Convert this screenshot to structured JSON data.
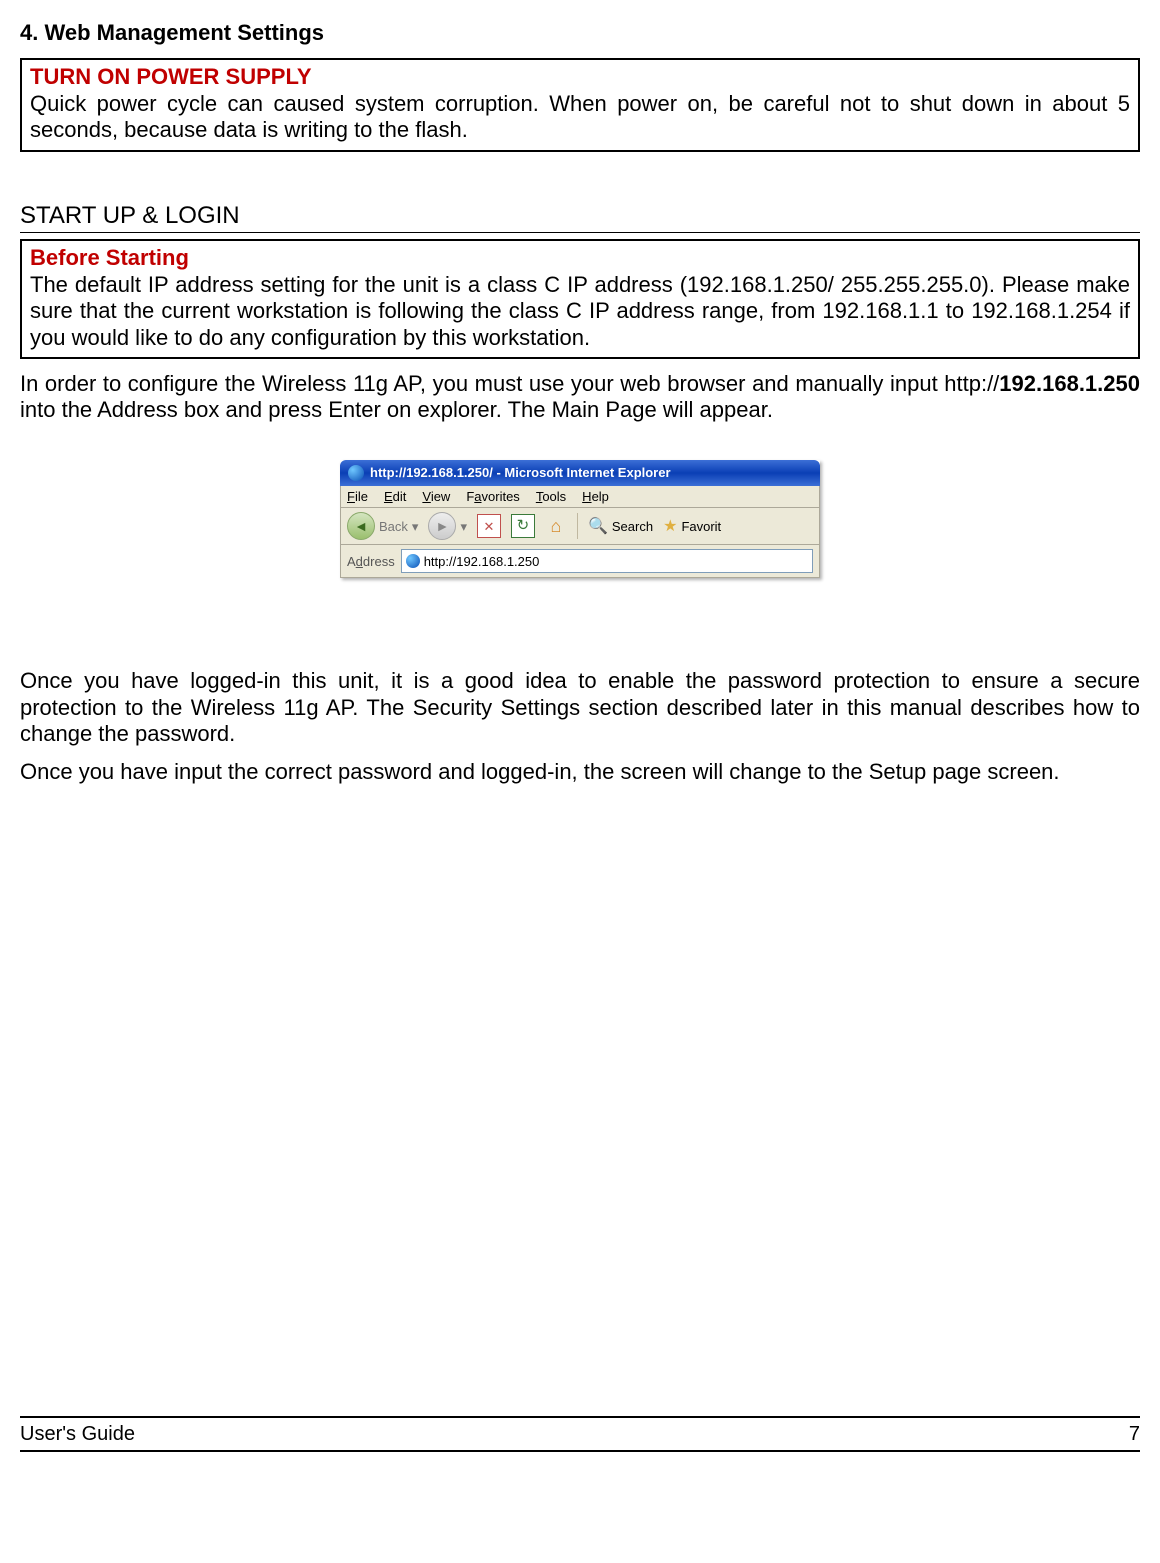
{
  "heading": {
    "number": "4.",
    "title": "Web Management Settings"
  },
  "box1": {
    "title": "TURN ON POWER SUPPLY",
    "body": "Quick power cycle can caused system corruption. When power on, be careful not to shut down in about 5 seconds, because data is writing to the flash."
  },
  "subsection": "START UP & LOGIN",
  "box2": {
    "title": "Before Starting",
    "body": "The default IP address setting for the unit is a class C IP address (192.168.1.250/ 255.255.255.0). Please make sure that the current workstation is following the class C IP address range, from 192.168.1.1 to 192.168.1.254 if you would like to do any configuration by this workstation."
  },
  "para1_pre": "In order to configure the Wireless 11g AP, you must use your web browser and manually input http://",
  "para1_bold": "192.168.1.250",
  "para1_post": " into the Address box and press Enter on explorer. The Main Page will appear.",
  "ie": {
    "title": "http://192.168.1.250/ - Microsoft Internet Explorer",
    "menu": {
      "file": "File",
      "edit": "Edit",
      "view": "View",
      "fav": "Favorites",
      "tools": "Tools",
      "help": "Help"
    },
    "toolbar": {
      "back": "Back",
      "search": "Search",
      "favorit": "Favorit"
    },
    "address_label": "Address",
    "address": "http://192.168.1.250"
  },
  "para2": "Once you have logged-in this unit, it is a good idea to enable the password protection to ensure a secure protection to the Wireless 11g AP. The Security Settings section described later in this manual describes how to change the password.",
  "para3": "Once you have input the correct password and logged-in, the screen will change to the Setup page screen.",
  "footer": {
    "left": "User's Guide",
    "right": "7"
  }
}
